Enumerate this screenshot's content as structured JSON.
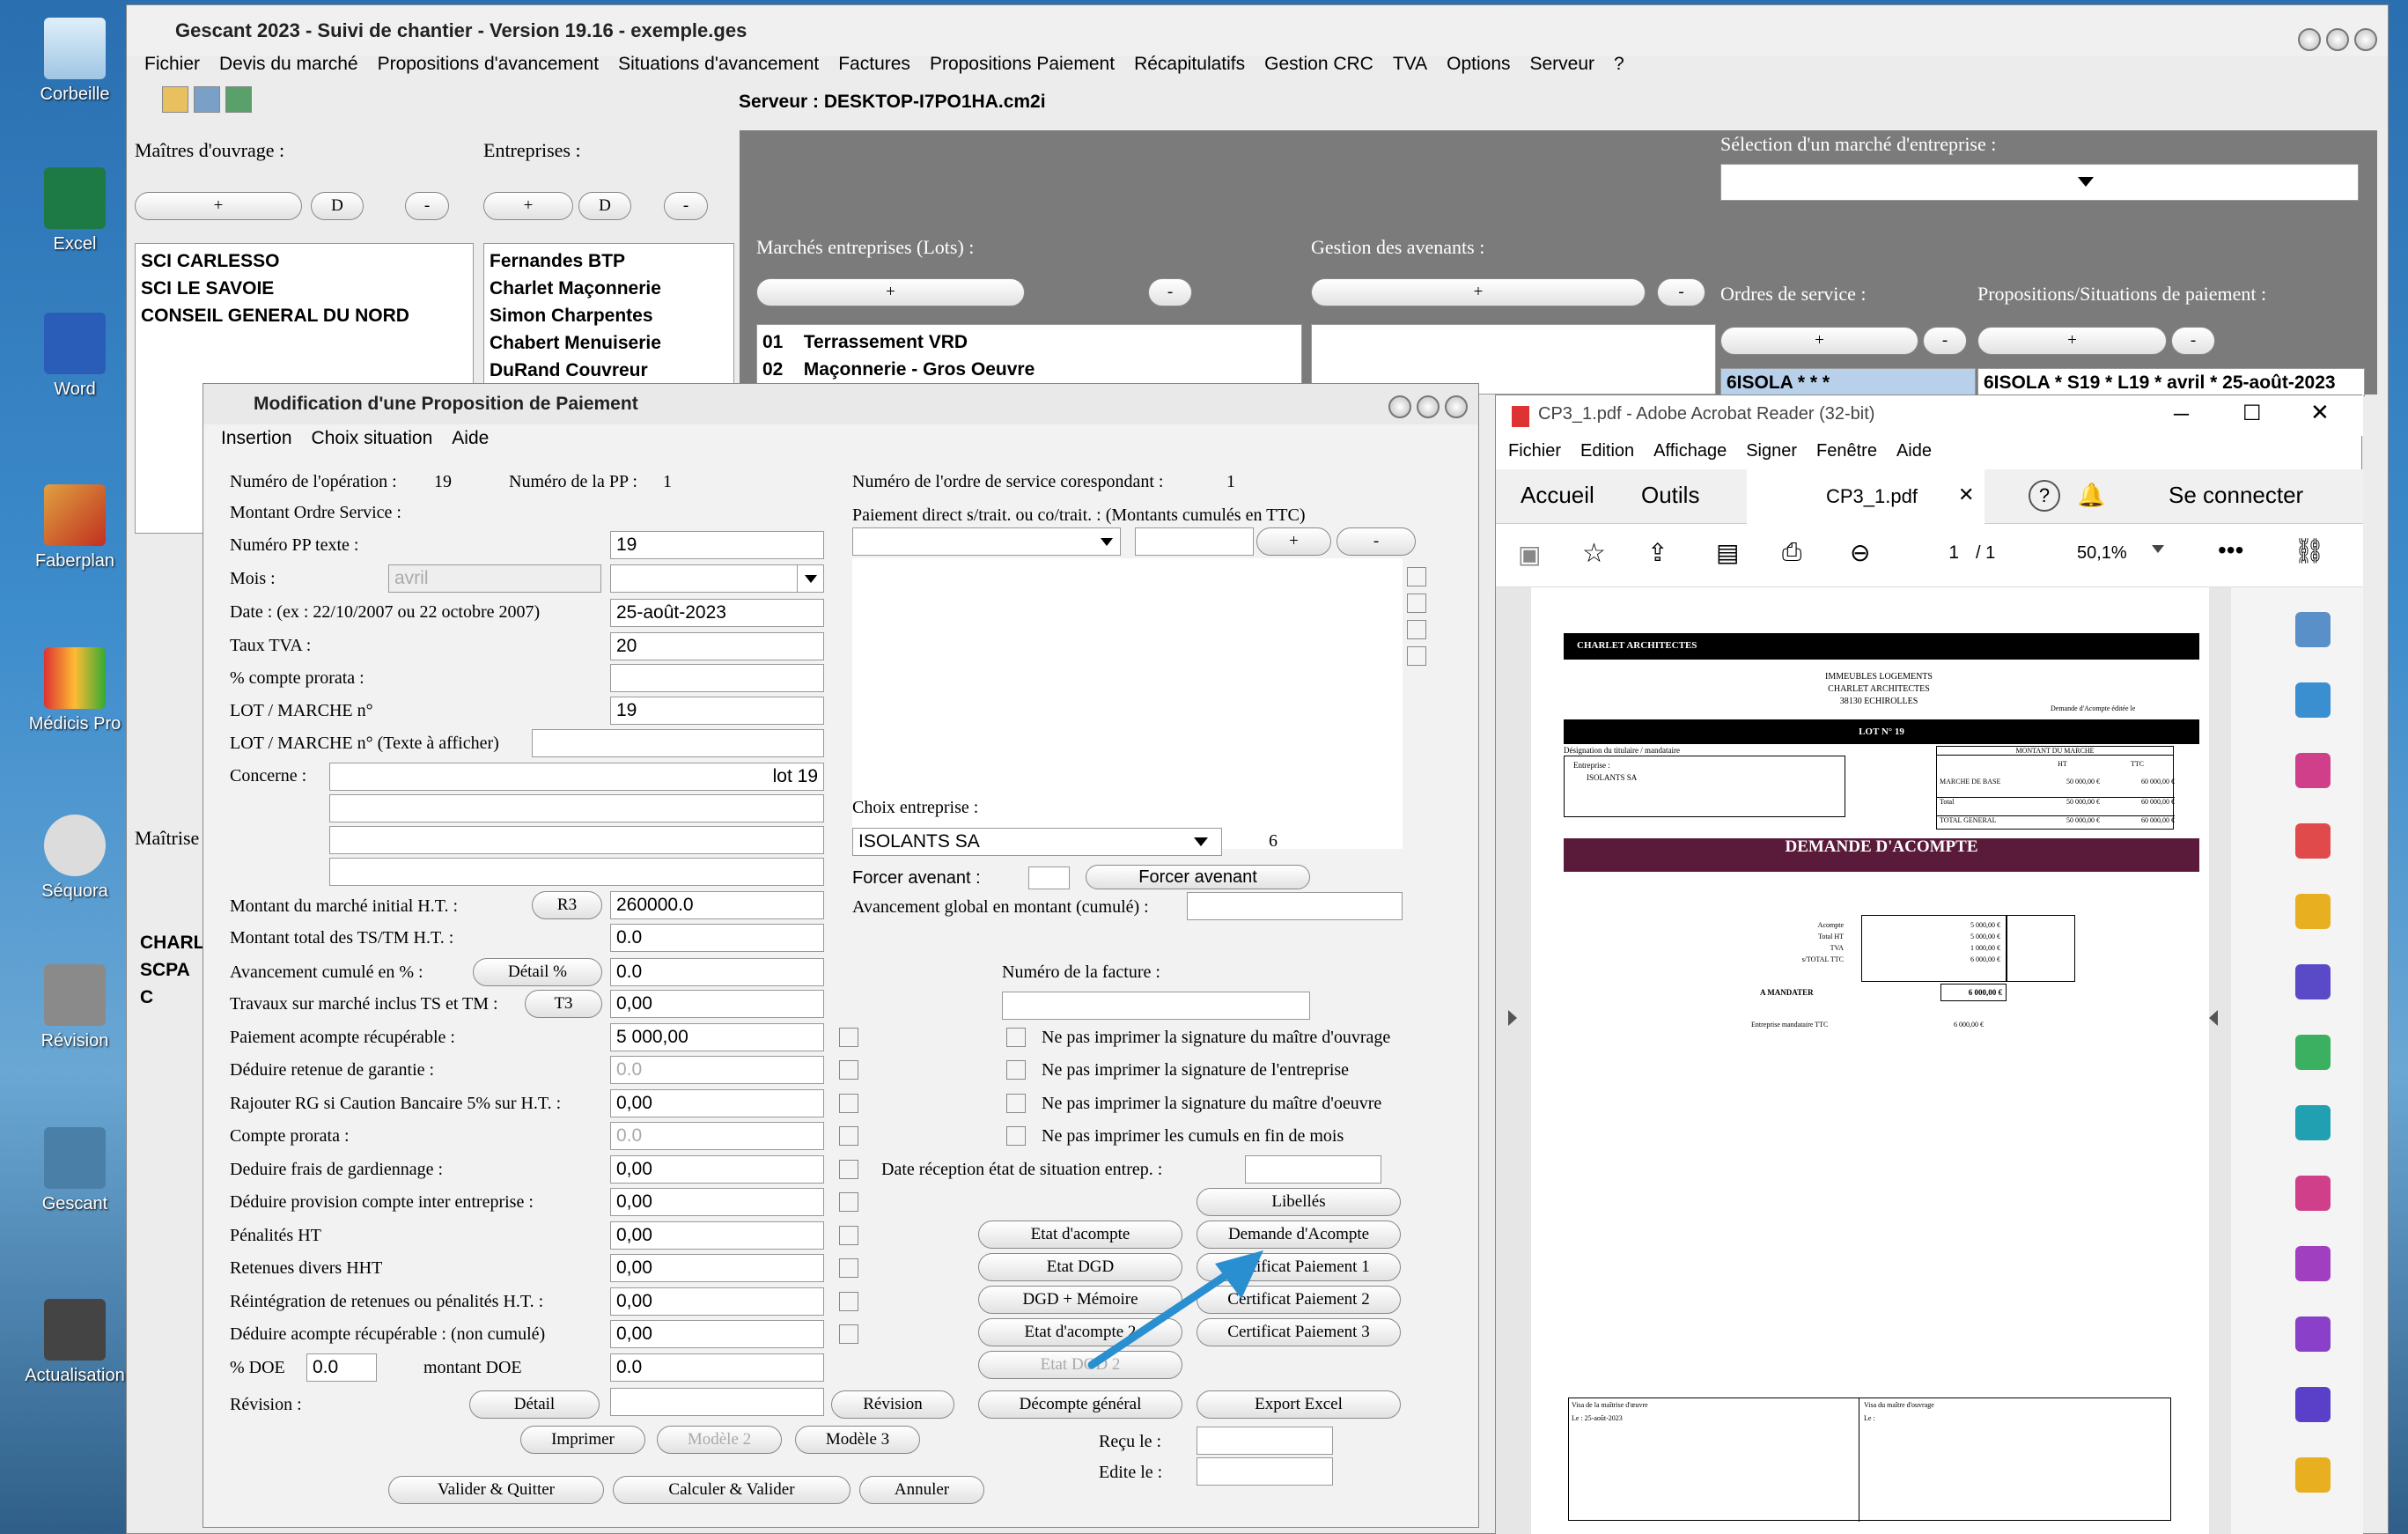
{
  "desktop": {
    "icons": [
      "Corbeille",
      "Excel",
      "Word",
      "Faberplan",
      "Médicis Pro",
      "Séquora",
      "Révision",
      "Gescant",
      "Actualisation"
    ]
  },
  "main": {
    "title": "Gescant 2023 - Suivi de chantier - Version 19.16 - exemple.ges",
    "menu": [
      "Fichier",
      "Devis du marché",
      "Propositions d'avancement",
      "Situations d'avancement",
      "Factures",
      "Propositions Paiement",
      "Récapitulatifs",
      "Gestion CRC",
      "TVA",
      "Options",
      "Serveur",
      "?"
    ],
    "server": "Serveur : DESKTOP-I7PO1HA.cm2i",
    "maitres_label": "Maîtres d'ouvrage :",
    "entreprises_label": "Entreprises :",
    "plus": "+",
    "minus": "-",
    "d": "D",
    "maitres": [
      "SCI CARLESSO",
      "SCI LE SAVOIE",
      "CONSEIL GENERAL DU NORD"
    ],
    "entreprises": [
      "Fernandes BTP",
      "Charlet Maçonnerie",
      "Simon Charpentes",
      "Chabert Menuiserie",
      "DuRand Couvreur"
    ],
    "selection_label": "Sélection d'un marché d'entreprise :",
    "marches_label": "Marchés entreprises (Lots) :",
    "avenants_label": "Gestion des avenants :",
    "lots": [
      {
        "n": "01",
        "name": "Terrassement VRD"
      },
      {
        "n": "02",
        "name": "Maçonnerie - Gros Oeuvre"
      }
    ],
    "os_label": "Ordres de service :",
    "props_label": "Propositions/Situations de paiement :",
    "os_item": "6ISOLA *  *  *",
    "prop_item": "6ISOLA * S19 * L19 * avril * 25-août-2023",
    "maitrise_label": "Maîtrise",
    "bottom_list": [
      "CHARL",
      "SCPA C"
    ]
  },
  "dialog": {
    "title": "Modification d'une Proposition de Paiement",
    "menu": [
      "Insertion",
      "Choix situation",
      "Aide"
    ],
    "num_op_label": "Numéro de l'opération :",
    "num_op": "19",
    "num_pp_label": "Numéro de la PP :",
    "num_pp": "1",
    "montant_os_label": "Montant Ordre Service :",
    "num_pp_texte_label": "Numéro PP texte :",
    "num_pp_texte": "19",
    "mois_label": "Mois  :",
    "mois": "avril",
    "date_label": "Date : (ex : 22/10/2007 ou 22 octobre 2007)",
    "date": "25-août-2023",
    "tva_label": "Taux TVA :",
    "tva": "20",
    "prorata_label": "% compte prorata :",
    "lot_label": "LOT / MARCHE n°",
    "lot": "19",
    "lot_texte_label": "LOT / MARCHE n° (Texte à afficher)",
    "concerne_label": "Concerne :",
    "concerne": "lot 19",
    "num_os_label": "Numéro de l'ordre de service corespondant :",
    "num_os": "1",
    "paiement_direct_label": "Paiement direct s/trait. ou co/trait. : (Montants cumulés en TTC)",
    "choix_ent_label": "Choix entreprise :",
    "choix_ent": "ISOLANTS SA",
    "choix_ent_num": "6",
    "forcer_label": "Forcer avenant :",
    "forcer_btn": "Forcer avenant",
    "avancement_global_label": "Avancement global en montant (cumulé) :",
    "rows": [
      {
        "label": "Montant du marché initial H.T. :",
        "btn": "R3",
        "value": "260000.0"
      },
      {
        "label": "Montant total des TS/TM H.T. :",
        "value": "0.0"
      },
      {
        "label": "Avancement cumulé en % :",
        "btn": "Détail %",
        "value": "0.0"
      },
      {
        "label": "Travaux sur marché inclus TS et TM :",
        "btn": "T3",
        "value": "0,00"
      },
      {
        "label": "Paiement acompte récupérable :",
        "value": "5 000,00"
      },
      {
        "label": "Déduire retenue de garantie :",
        "value": "0.0"
      },
      {
        "label": "Rajouter RG si Caution Bancaire 5% sur H.T. :",
        "value": "0,00"
      },
      {
        "label": "Compte prorata :",
        "value": "0.0"
      },
      {
        "label": "Deduire frais de gardiennage :",
        "value": "0,00"
      },
      {
        "label": "Déduire provision compte inter entreprise :",
        "value": "0,00"
      },
      {
        "label": "Pénalités HT",
        "value": "0,00"
      },
      {
        "label": "Retenues divers HHT",
        "value": "0,00"
      },
      {
        "label": "Réintégration de retenues ou pénalités H.T. :",
        "value": "0,00"
      },
      {
        "label": "Déduire acompte récupérable : (non cumulé)",
        "value": "0,00"
      }
    ],
    "doe_label": "% DOE",
    "doe": "0.0",
    "montant_doe_label": "montant DOE",
    "montant_doe": "0.0",
    "facture_label": "Numéro de la facture :",
    "checks": [
      "Ne pas imprimer la signature du maître d'ouvrage",
      "Ne pas imprimer la signature de l'entreprise",
      "Ne pas imprimer la signature du maître d'oeuvre",
      "Ne pas imprimer les cumuls en fin de mois"
    ],
    "date_recep_label": "Date réception état de situation entrep. :",
    "btns": {
      "libelles": "Libellés",
      "etat_acompte": "Etat d'acompte",
      "demande": "Demande d'Acompte",
      "etat_dgd": "Etat DGD",
      "cert1": "Certificat Paiement 1",
      "dgd_memoire": "DGD + Mémoire",
      "cert2": "Certificat Paiement 2",
      "etat_acompte2": "Etat d'acompte 2",
      "cert3": "Certificat Paiement 3",
      "etat_dgd2": "Etat DGD 2",
      "revision_label": "Révision :",
      "detail": "Détail",
      "revision": "Révision",
      "decompte": "Décompte général",
      "export": "Export Excel",
      "imprimer": "Imprimer",
      "modele2": "Modèle 2",
      "modele3": "Modèle 3",
      "recu": "Reçu le  :",
      "edite": "Edite le  :",
      "valider": "Valider & Quitter",
      "calculer": "Calculer & Valider",
      "annuler": "Annuler"
    }
  },
  "pdf": {
    "title": "CP3_1.pdf - Adobe Acrobat Reader (32-bit)",
    "menu": [
      "Fichier",
      "Edition",
      "Affichage",
      "Signer",
      "Fenêtre",
      "Aide"
    ],
    "tabs": {
      "accueil": "Accueil",
      "outils": "Outils",
      "doc": "CP3_1.pdf",
      "connect": "Se connecter",
      "help": "?"
    },
    "page": "1",
    "pages": "/ 1",
    "zoom": "50,1%",
    "doc": {
      "header": "CHARLET ARCHITECTES",
      "addr1": "IMMEUBLES LOGEMENTS",
      "addr2": "CHARLET ARCHITECTES",
      "addr3": "38130 ECHIROLLES",
      "edited": "Demande d'Acompte éditée le",
      "lot": "LOT N° 19",
      "designation": "Désignation du titulaire / mandataire",
      "entreprise": "Entreprise :",
      "isolants": "ISOLANTS SA",
      "montant_marche": "MONTANT DU MARCHE",
      "ht": "HT",
      "ttc": "TTC",
      "base": "MARCHE DE BASE",
      "base_ht": "50 000,00 €",
      "base_ttc": "60 000,00 €",
      "total": "Total",
      "total_general": "TOTAL GENERAL",
      "big": "DEMANDE D'ACOMPTE",
      "acompte": "Acompte",
      "acompte_v": "5 000,00 €",
      "total_ht": "Total HT",
      "total_ht_v": "5 000,00 €",
      "tva": "TVA",
      "tva_v": "1 000,00 €",
      "sstotal": "s/TOTAL TTC",
      "sstotal_v": "6 000,00 €",
      "mandater": "A MANDATER",
      "mandater_v": "6 000,00 €",
      "ent_mand": "Entreprise mandataire TTC",
      "ent_mand_v": "6 000,00 €",
      "visa1": "Visa de la maîtrise d'œuvre",
      "visa2": "Visa du maître d'ouvrage",
      "le1": "Le : 25-août-2023",
      "le2": "Le :"
    }
  }
}
